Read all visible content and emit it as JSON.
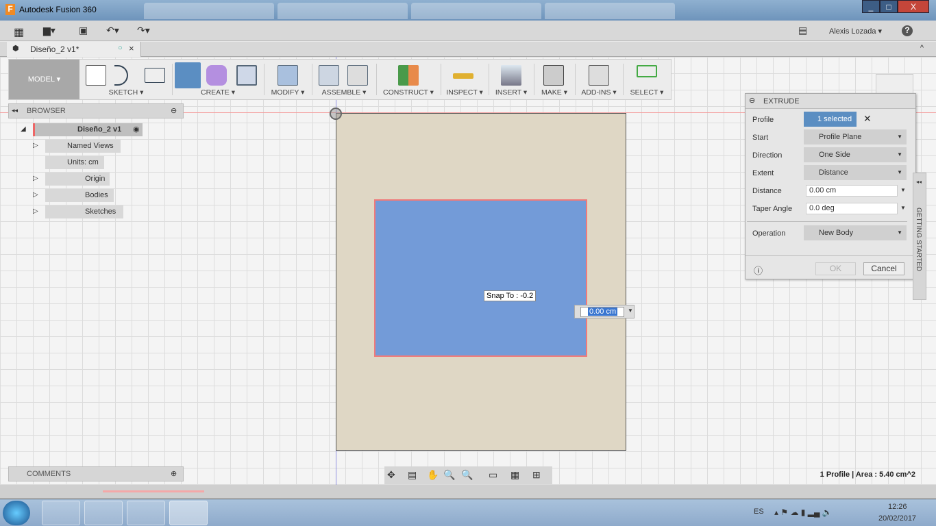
{
  "window": {
    "title": "Autodesk Fusion 360",
    "controls": [
      "_",
      "□",
      "X"
    ]
  },
  "topbar": {
    "user": "Alexis Lozada ▾",
    "help": "?"
  },
  "doc_tab": {
    "name": "Diseño_2 v1*"
  },
  "toolbar": {
    "model": "MODEL ▾",
    "groups": [
      "SKETCH ▾",
      "CREATE ▾",
      "MODIFY ▾",
      "ASSEMBLE ▾",
      "CONSTRUCT ▾",
      "INSPECT ▾",
      "INSERT ▾",
      "MAKE ▾",
      "ADD-INS ▾",
      "SELECT ▾"
    ]
  },
  "browser": {
    "title": "BROWSER",
    "root": "Diseño_2 v1",
    "items": [
      "Named Views",
      "Units: cm",
      "Origin",
      "Bodies",
      "Sketches"
    ]
  },
  "canvas": {
    "snap": "Snap To : -0.2",
    "distance_input": "0.00 cm"
  },
  "extrude": {
    "title": "EXTRUDE",
    "rows": [
      {
        "label": "Profile",
        "value": "1 selected"
      },
      {
        "label": "Start",
        "value": "Profile Plane"
      },
      {
        "label": "Direction",
        "value": "One Side"
      },
      {
        "label": "Extent",
        "value": "Distance"
      },
      {
        "label": "Distance",
        "value": "0.00 cm"
      },
      {
        "label": "Taper Angle",
        "value": "0.0 deg"
      },
      {
        "label": "Operation",
        "value": "New Body"
      }
    ],
    "ok": "OK",
    "cancel": "Cancel"
  },
  "getting_started": "GETTING STARTED",
  "comments": "COMMENTS",
  "status": "1 Profile | Area : 5.40 cm^2",
  "tray": {
    "lang": "ES",
    "time": "12:26",
    "date": "20/02/2017"
  },
  "colors": {
    "profile": "#739bd8",
    "selected": "#5b8ec2",
    "accent": "#ff0000"
  }
}
